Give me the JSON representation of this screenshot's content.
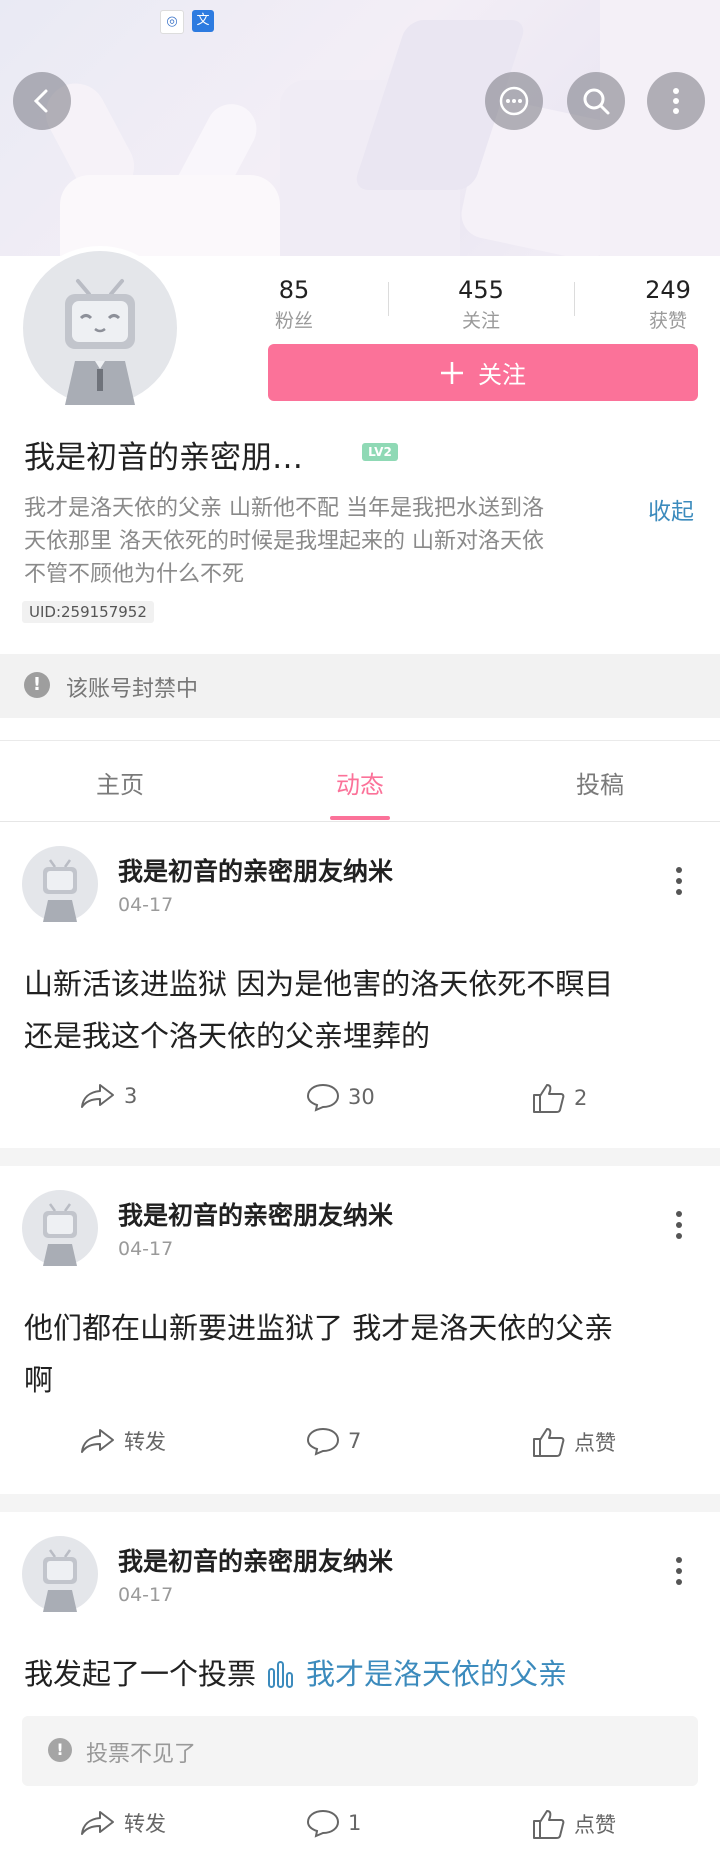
{
  "header": {
    "status_icons": [
      "app-icon-1",
      "app-icon-2"
    ],
    "buttons": [
      "back-icon",
      "message-icon",
      "search-icon",
      "more-vertical-icon"
    ]
  },
  "profile": {
    "stats": [
      {
        "value": "85",
        "label": "粉丝"
      },
      {
        "value": "455",
        "label": "关注"
      },
      {
        "value": "249",
        "label": "获赞"
      }
    ],
    "follow_label": "关注",
    "name": "我是初音的亲密朋…",
    "level": "LV2",
    "bio_lines": [
      "我才是洛天依的父亲 山新他不配 当年是我把水送到洛",
      "天依那里 洛天依死的时候是我埋起来的 山新对洛天依",
      "不管不顾他为什么不死"
    ],
    "collapse_label": "收起",
    "uid": "UID:259157952",
    "banned_text": "该账号封禁中"
  },
  "tabs": [
    {
      "label": "主页",
      "active": false
    },
    {
      "label": "动态",
      "active": true
    },
    {
      "label": "投稿",
      "active": false
    }
  ],
  "posts": [
    {
      "author": "我是初音的亲密朋友纳米",
      "date": "04-17",
      "lines": [
        "山新活该进监狱 因为是他害的洛天依死不瞑目",
        "还是我这个洛天依的父亲埋葬的"
      ],
      "share": "3",
      "comments": "30",
      "likes": "2"
    },
    {
      "author": "我是初音的亲密朋友纳米",
      "date": "04-17",
      "lines": [
        "他们都在山新要进监狱了 我才是洛天依的父亲",
        "啊"
      ],
      "share": "转发",
      "comments": "7",
      "likes": "点赞"
    },
    {
      "author": "我是初音的亲密朋友纳米",
      "date": "04-17",
      "vote_prefix": "我发起了一个投票",
      "vote_link": "我才是洛天依的父亲",
      "vote_missing": "投票不见了",
      "share": "转发",
      "comments": "1",
      "likes": "点赞"
    }
  ],
  "colors": {
    "accent": "#fb7299",
    "link": "#3c8bbd"
  }
}
